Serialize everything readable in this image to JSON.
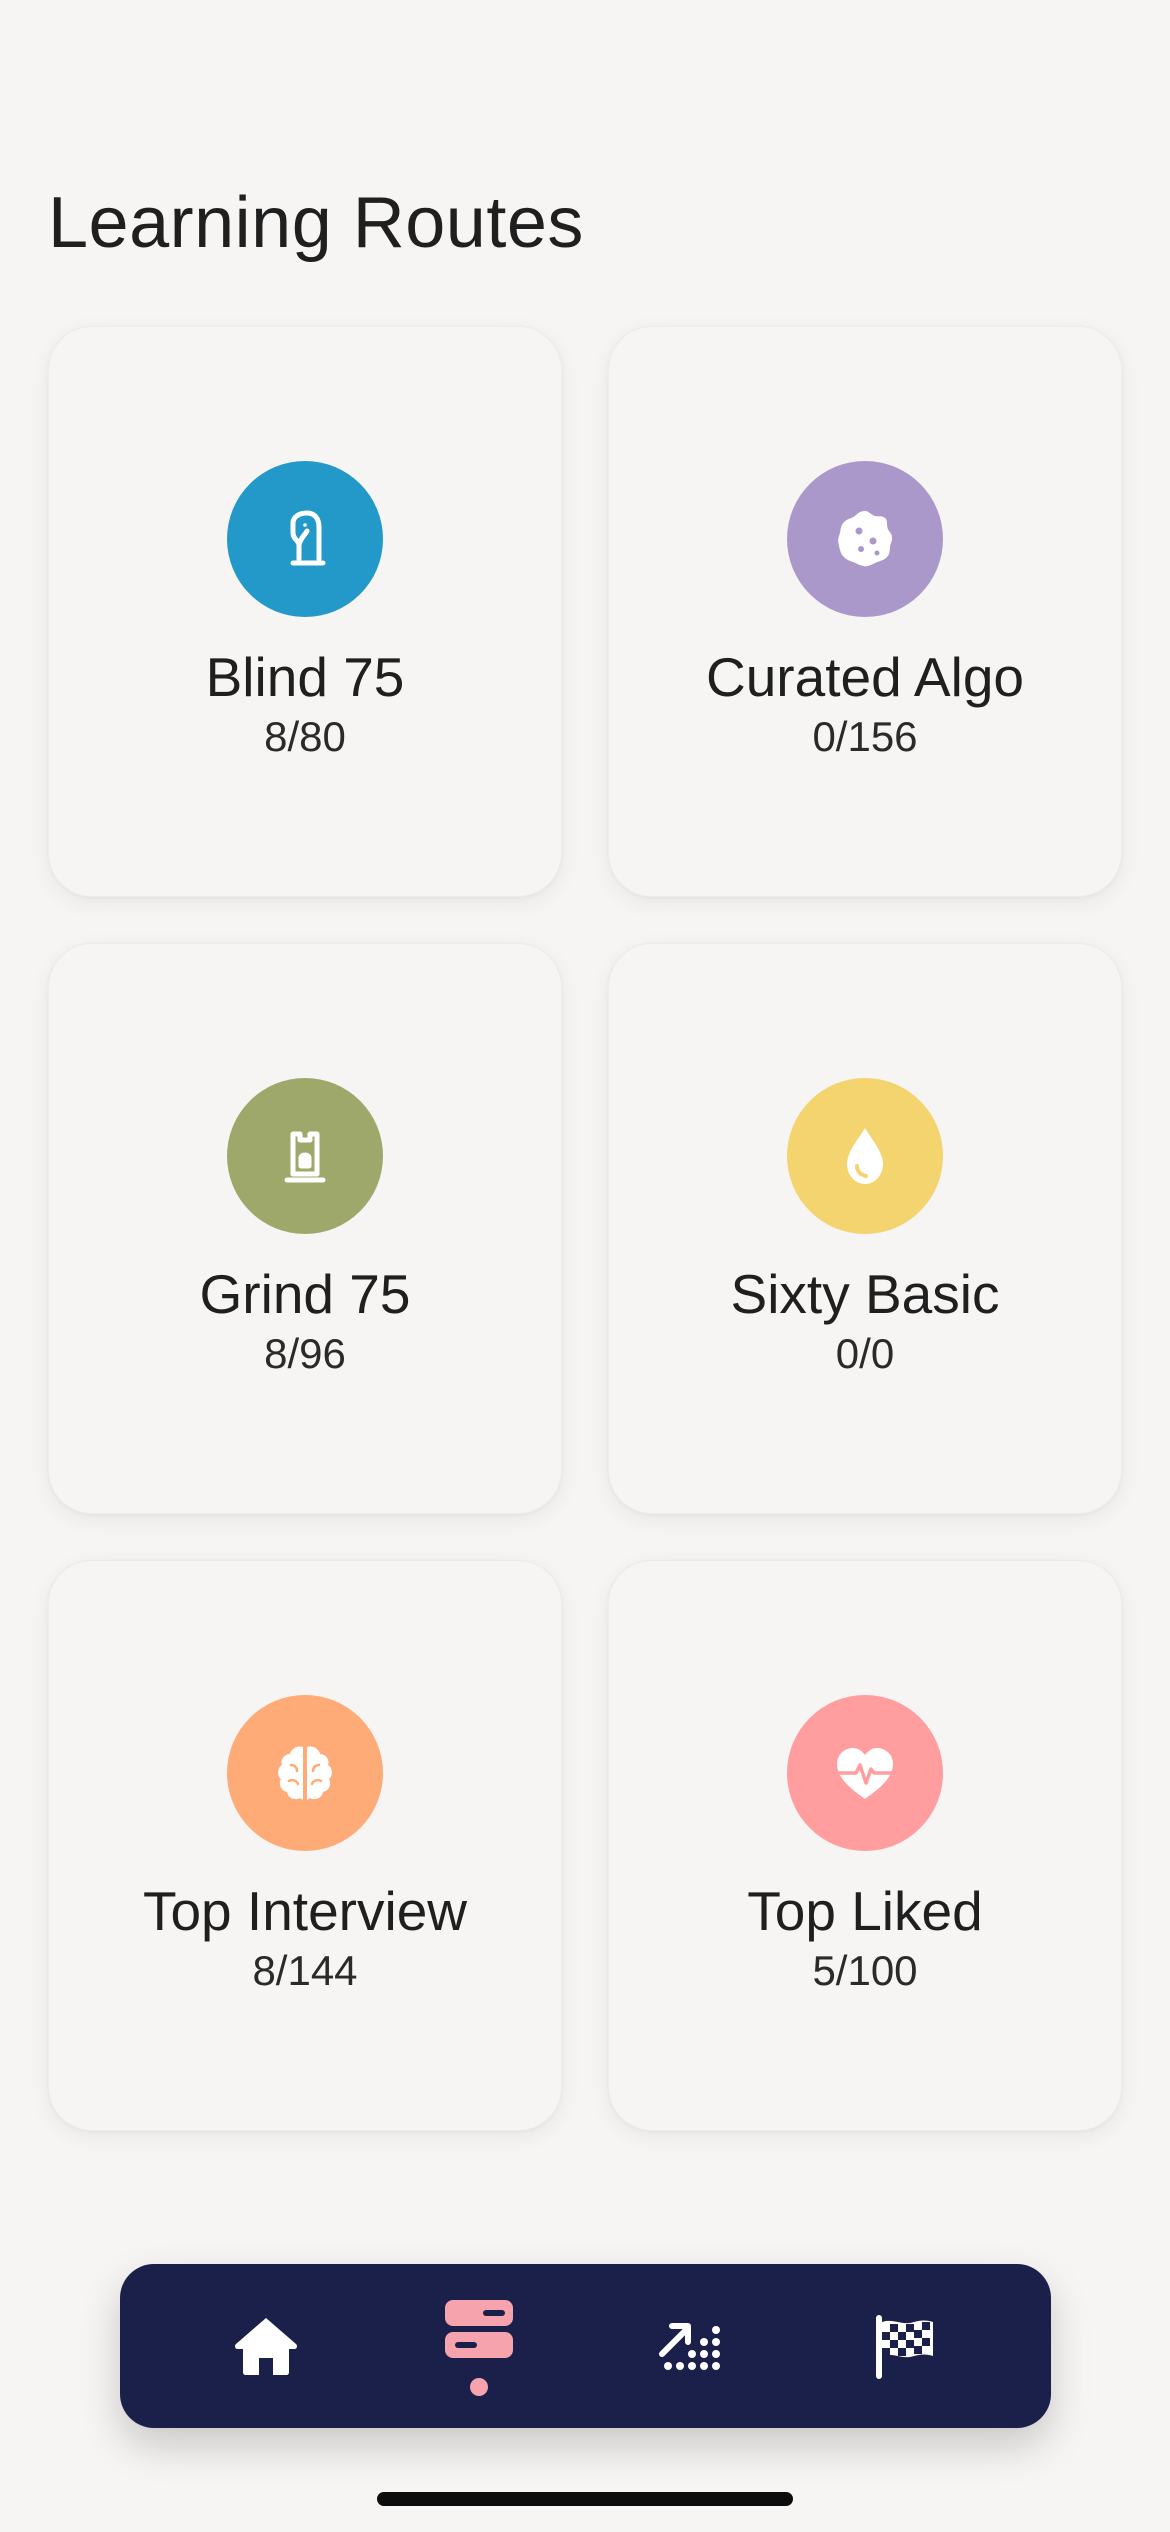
{
  "page": {
    "title": "Learning Routes"
  },
  "routes": [
    {
      "name": "Blind 75",
      "progress": "8/80",
      "color": "#2299c8",
      "icon": "chess-knight-icon"
    },
    {
      "name": "Curated Algo",
      "progress": "0/156",
      "color": "#aa98cb",
      "icon": "cookie-icon"
    },
    {
      "name": "Grind 75",
      "progress": "8/96",
      "color": "#9fa86b",
      "icon": "chess-rook-icon"
    },
    {
      "name": "Sixty Basic",
      "progress": "0/0",
      "color": "#f4d46f",
      "icon": "water-drop-icon"
    },
    {
      "name": "Top Interview",
      "progress": "8/144",
      "color": "#ffab78",
      "icon": "brain-icon"
    },
    {
      "name": "Top Liked",
      "progress": "5/100",
      "color": "#ff9d9f",
      "icon": "heart-pulse-icon"
    }
  ],
  "nav": {
    "background": "#1a2049",
    "active_color": "#f7a3ad",
    "items": [
      {
        "icon": "home-icon",
        "active": false
      },
      {
        "icon": "routes-list-icon",
        "active": true
      },
      {
        "icon": "progress-chart-icon",
        "active": false
      },
      {
        "icon": "checkered-flag-icon",
        "active": false
      }
    ]
  }
}
